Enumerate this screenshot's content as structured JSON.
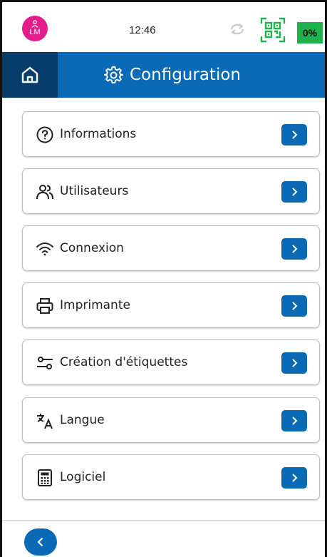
{
  "status": {
    "avatar_initials": "LM",
    "time": "12:46",
    "battery": "0%",
    "icons": [
      "user-icon",
      "sync-icon",
      "qr-code-icon"
    ]
  },
  "header": {
    "title": "Configuration",
    "home_icon": "home-icon",
    "title_icon": "gear-icon"
  },
  "menu": {
    "items": [
      {
        "label": "Informations",
        "icon": "help-circle-icon"
      },
      {
        "label": "Utilisateurs",
        "icon": "users-icon"
      },
      {
        "label": "Connexion",
        "icon": "wifi-icon"
      },
      {
        "label": "Imprimante",
        "icon": "printer-icon"
      },
      {
        "label": "Création d'étiquettes",
        "icon": "sliders-icon"
      },
      {
        "label": "Langue",
        "icon": "translate-icon"
      },
      {
        "label": "Logiciel",
        "icon": "calculator-icon"
      }
    ]
  },
  "colors": {
    "primary": "#0a6ab5",
    "primary_dark": "#063d6b",
    "avatar": "#e31e8c",
    "battery": "#1fb14e",
    "qr": "#1fb14e"
  }
}
